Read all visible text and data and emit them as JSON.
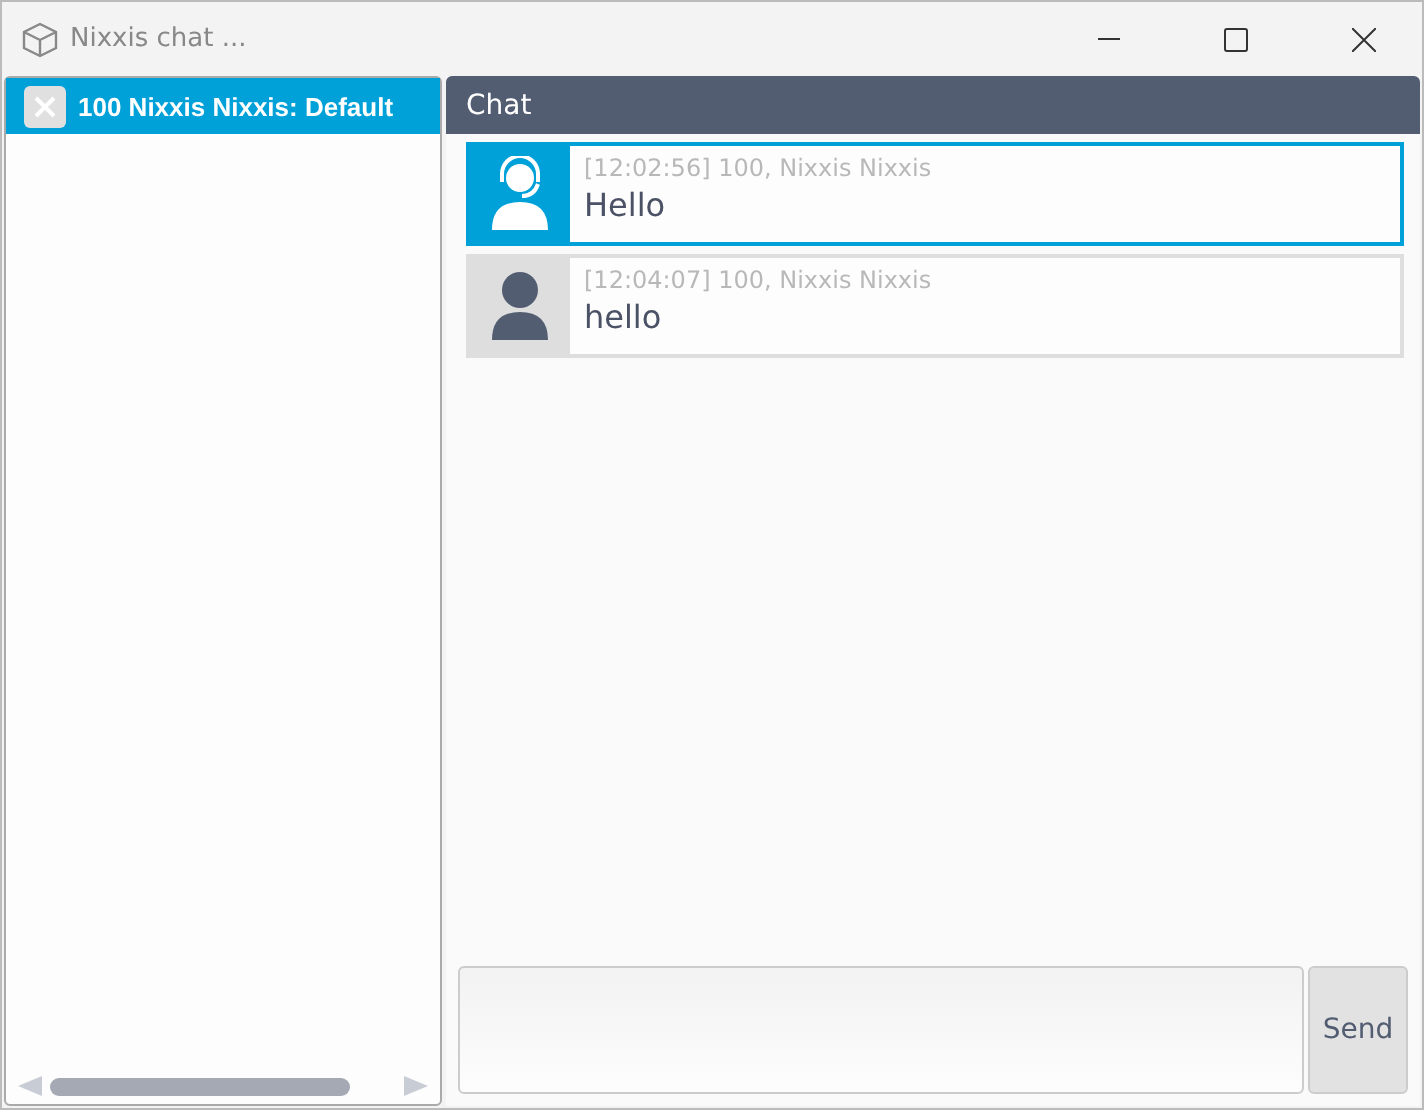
{
  "window": {
    "title": "Nixxis chat ..."
  },
  "sessions": [
    {
      "label": "100 Nixxis Nixxis: Default",
      "selected": true
    }
  ],
  "chat": {
    "header": "Chat",
    "messages": [
      {
        "kind": "agent",
        "selected": true,
        "meta": "[12:02:56] 100, Nixxis Nixxis",
        "text": "Hello"
      },
      {
        "kind": "user",
        "selected": false,
        "meta": "[12:04:07] 100, Nixxis Nixxis",
        "text": "hello"
      }
    ]
  },
  "composer": {
    "send": "Send"
  }
}
